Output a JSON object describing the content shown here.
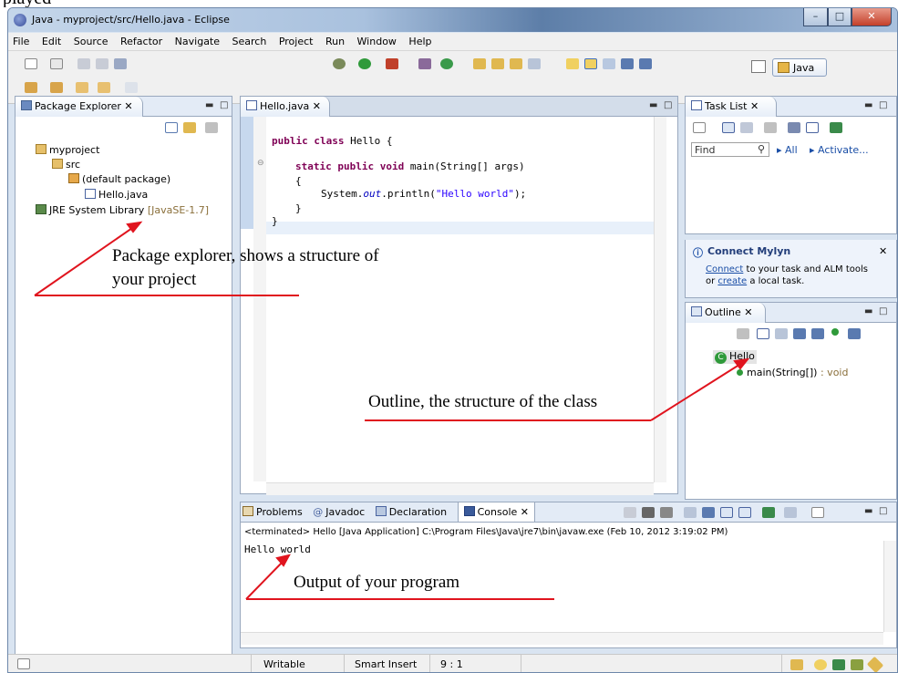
{
  "caption_fragment": "played",
  "window": {
    "title": "Java - myproject/src/Hello.java - Eclipse"
  },
  "menu": [
    "File",
    "Edit",
    "Source",
    "Refactor",
    "Navigate",
    "Search",
    "Project",
    "Run",
    "Window",
    "Help"
  ],
  "perspective": {
    "label": "Java"
  },
  "package_explorer": {
    "tab": "Package Explorer",
    "tree": {
      "project": "myproject",
      "src": "src",
      "package": "(default package)",
      "file": "Hello.java",
      "library": "JRE System Library",
      "library_version": "[JavaSE-1.7]"
    }
  },
  "editor": {
    "tab": "Hello.java",
    "code": {
      "l1_kw": "public class",
      "l1_rest": " Hello {",
      "l2_kw": "static public void",
      "l2_rest": " main(String[] args)",
      "l3": "{",
      "l4_a": "System.",
      "l4_out": "out",
      "l4_b": ".println(",
      "l4_str": "\"Hello world\"",
      "l4_c": ");",
      "l5": "}",
      "l6": "}"
    }
  },
  "task_list": {
    "tab": "Task List",
    "find_placeholder": "Find",
    "all": "All",
    "activate": "Activate..."
  },
  "mylyn": {
    "title": "Connect Mylyn",
    "connect": "Connect",
    "text1": " to your task and ALM tools",
    "text2_pre": "or ",
    "create": "create",
    "text2_post": " a local task."
  },
  "outline": {
    "tab": "Outline",
    "class_name": "Hello",
    "method": "main(String[])",
    "method_type": " : void"
  },
  "console": {
    "tabs": [
      "Problems",
      "Javadoc",
      "Declaration",
      "Console"
    ],
    "terminated": "<terminated> Hello [Java Application] C:\\Program Files\\Java\\jre7\\bin\\javaw.exe (Feb 10, 2012 3:19:02 PM)",
    "output": "Hello world"
  },
  "status": {
    "writable": "Writable",
    "insert": "Smart Insert",
    "position": "9 : 1"
  },
  "annotations": {
    "pkg_line1": "Package explorer, shows a structure of",
    "pkg_line2": "your project",
    "outline": "Outline, the structure of the class",
    "output": "Output of your program"
  },
  "colors": {
    "annotation_arrow": "#e0141e",
    "keyword": "#7f0055",
    "string": "#2a00ff"
  }
}
